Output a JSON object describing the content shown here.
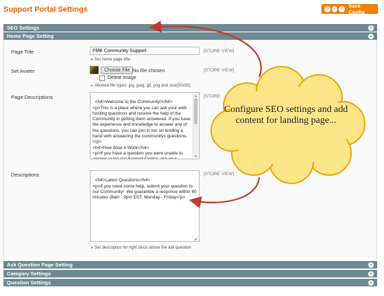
{
  "header": {
    "title": "Support Portal Settings",
    "save_label": "Save Config"
  },
  "sections": {
    "seo": "SEO Settings",
    "home": "Home Page Setting",
    "ask": "Ask Question Page Setting",
    "category": "Category Settings",
    "question": "Question Settings"
  },
  "fields": {
    "page_title": {
      "label": "Page Title",
      "value": "FME Community Support",
      "scope": "[STORE VIEW]",
      "hint": "Set home page title"
    },
    "avatar": {
      "label": "Set Avater",
      "button": "Choose File",
      "status": "No file chosen",
      "delete_label": "Delete Image",
      "scope": "[STORE VIEW]",
      "hint": "Allowed file types: jpg, jpeg, gif, png and size(50x50)"
    },
    "page_descriptions": {
      "label": "Page Descriptions",
      "scope": "[STORE",
      "value": "<h4>Welcome to the Community!</h4>\n<p>This is a place where you can ask your web hosting questions and receive the help of the Community in getting them answered. If you have the experience and knowledge to answer any of the questions, you can join in too on lending a hand with answering the communitys questions.</p>\n<h4>How dose it Work</h4>\n<p>If you have a question you were unable to answer using our Support Center, ask your question to the Community. InMotion Hosting"
    },
    "descriptions": {
      "label": "Descriptions",
      "scope": "[STORE VIEW]",
      "value": "<h4>Latest Questions</h4>\n<p>If you need some help, submit your question to our Community!  We guarantee a response within 60 minutes (8am - 9pm EST, Monday - Friday</p>",
      "hint": "Set description for right block above the ask question"
    }
  },
  "callout": {
    "text": "Configure SEO settings and add content for landing page..."
  },
  "icons": {
    "arrow_hint": "triangle-right-icon",
    "section_toggle": "circle-chevron-icon"
  },
  "colors": {
    "accent": "#eb5e00",
    "button": "#f18200",
    "section_bar": "#6f8992",
    "cloud_fill": "#fde68a",
    "cloud_edge": "#f0a500",
    "arrow": "#c0392b"
  }
}
